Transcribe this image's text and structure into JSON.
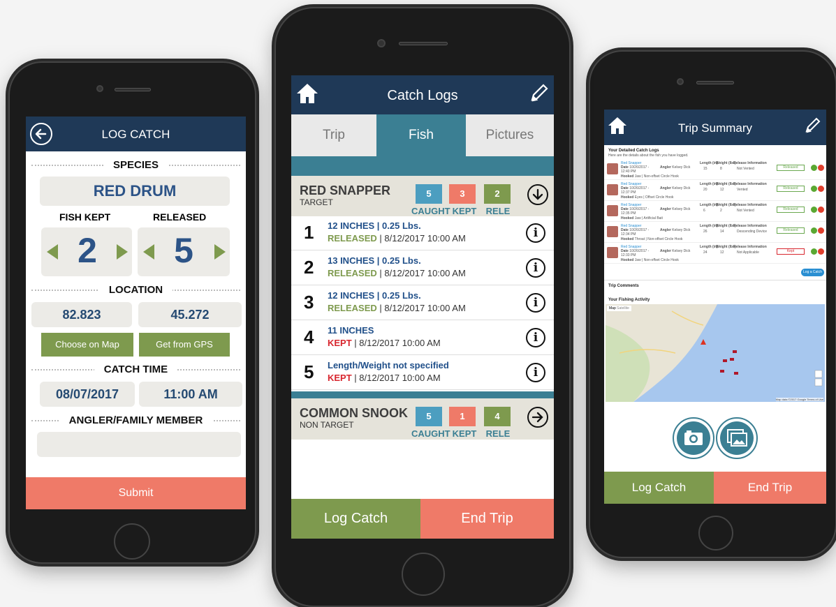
{
  "log_catch": {
    "title": "LOG CATCH",
    "species_heading": "SPECIES",
    "species_value": "RED DRUM",
    "kept_label": "FISH KEPT",
    "released_label": "RELEASED",
    "kept_count": "2",
    "released_count": "5",
    "location_heading": "LOCATION",
    "lat": "82.823",
    "lon": "45.272",
    "choose_map": "Choose on Map",
    "get_gps": "Get from GPS",
    "catch_time_heading": "CATCH TIME",
    "date": "08/07/2017",
    "time": "11:00 AM",
    "angler_heading": "ANGLER/FAMILY MEMBER",
    "submit": "Submit"
  },
  "catch_logs": {
    "title": "Catch Logs",
    "tabs": [
      "Trip",
      "Fish",
      "Pictures"
    ],
    "count_labels": [
      "CAUGHT",
      "KEPT",
      "RELE"
    ],
    "groups": [
      {
        "name": "RED SNAPPER",
        "type": "TARGET",
        "caught": "5",
        "kept": "3",
        "released": "2",
        "entries": [
          {
            "num": "1",
            "measure": "12 INCHES | 0.25 Lbs.",
            "status": "RELEASED",
            "when": " | 8/12/2017 10:00 AM"
          },
          {
            "num": "2",
            "measure": "13 INCHES | 0.25 Lbs.",
            "status": "RELEASED",
            "when": " | 8/12/2017 10:00 AM"
          },
          {
            "num": "3",
            "measure": "12 INCHES | 0.25 Lbs.",
            "status": "RELEASED",
            "when": " | 8/12/2017 10:00 AM"
          },
          {
            "num": "4",
            "measure": "11 INCHES",
            "status": "KEPT",
            "when": " | 8/12/2017 10:00 AM"
          },
          {
            "num": "5",
            "measure": "Length/Weight not specified",
            "status": "KEPT",
            "when": " | 8/12/2017 10:00 AM"
          }
        ]
      },
      {
        "name": "COMMON SNOOK",
        "type": "NON TARGET",
        "caught": "5",
        "kept": "1",
        "released": "4"
      }
    ],
    "log_catch_btn": "Log Catch",
    "end_trip_btn": "End Trip"
  },
  "trip_summary": {
    "title": "Trip Summary",
    "detail_heading": "Your Detailed Catch Logs",
    "detail_sub": "Here are the details about the fish you have logged.",
    "log_rows": [
      {
        "species": "Red Snapper",
        "date": "10/26/2017 - 12:40 PM",
        "angler": "Kelsey Dick",
        "hooked": "Jaw | Non-offset Circle Hook",
        "length": "15",
        "weight": "8",
        "release_info": "Not Vented",
        "badge": "Released"
      },
      {
        "species": "Red Snapper",
        "date": "10/26/2017 - 12:37 PM",
        "angler": "Kelsey Dick",
        "hooked": "Eyes | Offset Circle Hook",
        "length": "20",
        "weight": "12",
        "release_info": "Vented",
        "badge": "Released"
      },
      {
        "species": "Red Snapper",
        "date": "10/26/2017 - 12:35 PM",
        "angler": "Kelsey Dick",
        "hooked": "Jaw | Artificial Bait",
        "length": "6",
        "weight": "2",
        "release_info": "Not Vented",
        "badge": "Released"
      },
      {
        "species": "Red Snapper",
        "date": "10/26/2017 - 12:34 PM",
        "angler": "Kelsey Dick",
        "hooked": "Throat | Non-offset Circle Hook",
        "length": "26",
        "weight": "14",
        "release_info": "Descending Device",
        "badge": "Released"
      },
      {
        "species": "Red Snapper",
        "date": "10/26/2017 - 12:33 PM",
        "angler": "Kelsey Dick",
        "hooked": "Jaw | Non-offset Circle Hook",
        "length": "24",
        "weight": "12",
        "release_info": "Not Applicable",
        "badge": "Kept"
      }
    ],
    "col_length": "Length (in)",
    "col_weight": "Weight (lbs)",
    "col_release": "Release Information",
    "date_label": "Date",
    "angler_label": "Angler",
    "hooked_label": "Hooked",
    "log_catch_small": "Log a Catch",
    "comments_heading": "Trip Comments",
    "activity_heading": "Your Fishing Activity",
    "map_tab": "Map",
    "sat_tab": "Satellite",
    "map_credit": "Map data ©2017 Google   Terms of Use",
    "log_catch_btn": "Log Catch",
    "end_trip_btn": "End Trip"
  },
  "colors": {
    "navy": "#1f3957",
    "olive": "#7e9a4e",
    "salmon": "#ef7a68",
    "teal": "#3b7f93",
    "caught_blue": "#4c9ec0",
    "kept_salmon": "#ef7a68",
    "released_olive": "#7e9a4e"
  }
}
